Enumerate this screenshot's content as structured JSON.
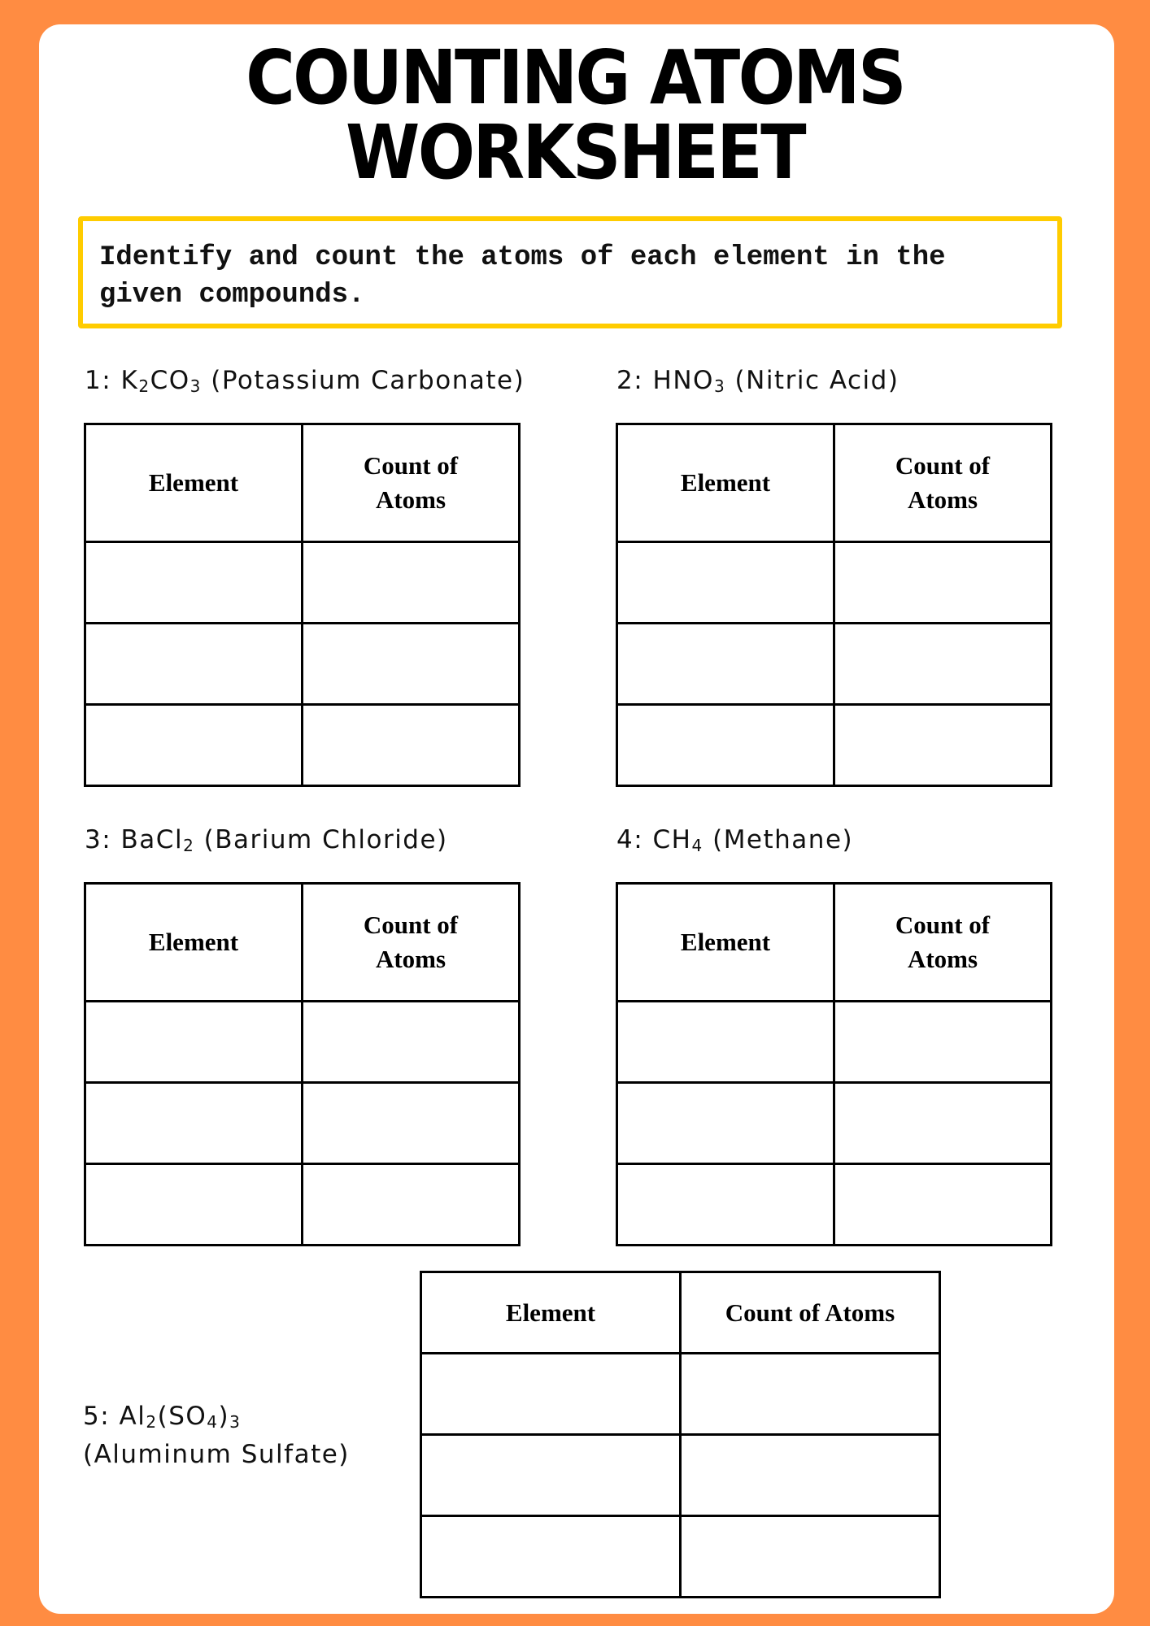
{
  "page": {
    "title_line1": "COUNTING ATOMS",
    "title_line2": "WORKSHEET",
    "instructions": "Identify and count the atoms of each element in the given compounds.",
    "colors": {
      "border": "#FF8C42",
      "instruction_box": "#FFCC00"
    }
  },
  "table_headers": {
    "element": "Element",
    "count": "Count of Atoms"
  },
  "problems": [
    {
      "number": "1:",
      "formula_parts": [
        "K",
        "2",
        "CO",
        "3"
      ],
      "name": "(Potassium Carbonate)",
      "rows": 3
    },
    {
      "number": "2:",
      "formula_parts": [
        "HNO",
        "3"
      ],
      "name": "(Nitric Acid)",
      "rows": 3
    },
    {
      "number": "3:",
      "formula_parts": [
        "BaCl",
        "2"
      ],
      "name": "(Barium Chloride)",
      "rows": 3
    },
    {
      "number": "4:",
      "formula_parts": [
        "CH",
        "4"
      ],
      "name": "(Methane)",
      "rows": 3
    },
    {
      "number": "5:",
      "formula_parts": [
        "Al",
        "2",
        "(SO",
        "4",
        ")",
        "3"
      ],
      "name": "(Aluminum Sulfate)",
      "rows": 3
    }
  ]
}
